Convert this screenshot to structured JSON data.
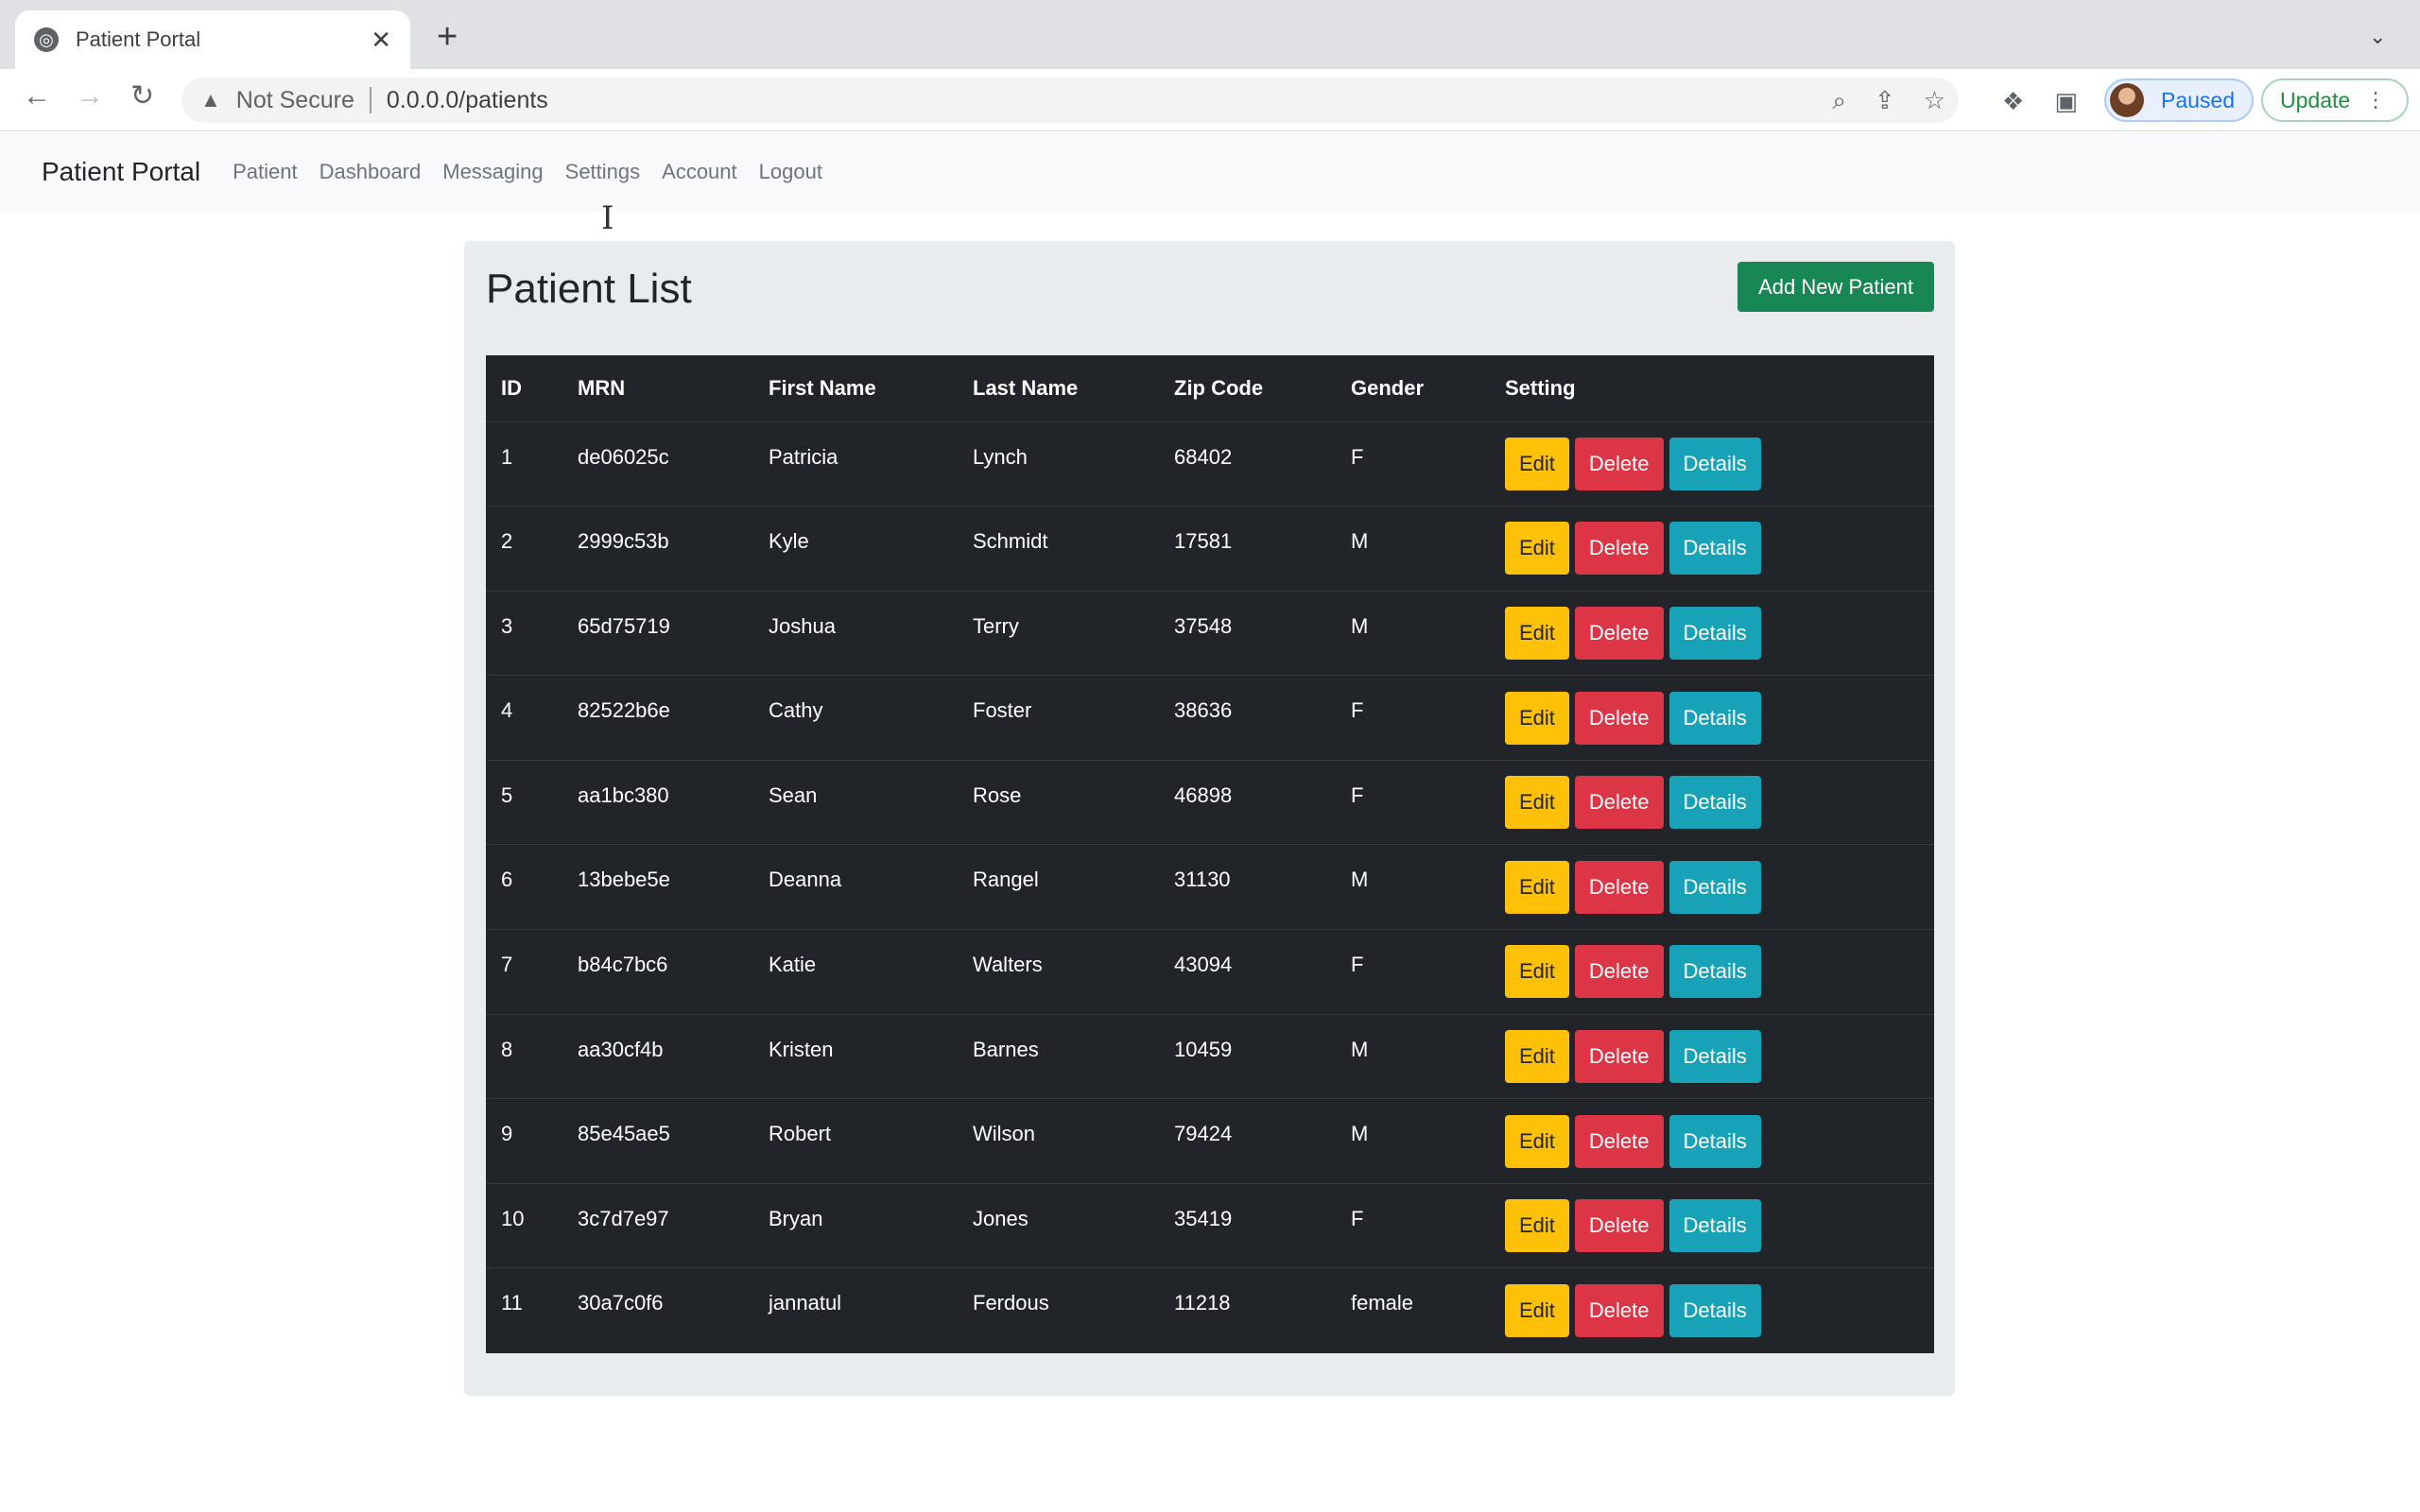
{
  "browser": {
    "tab_title": "Patient Portal",
    "security_label": "Not Secure",
    "url": "0.0.0.0/patients",
    "profile_status": "Paused",
    "update_label": "Update"
  },
  "navbar": {
    "brand": "Patient Portal",
    "links": [
      "Patient",
      "Dashboard",
      "Messaging",
      "Settings",
      "Account",
      "Logout"
    ]
  },
  "main": {
    "title": "Patient List",
    "add_button": "Add New Patient",
    "columns": [
      "ID",
      "MRN",
      "First Name",
      "Last Name",
      "Zip Code",
      "Gender",
      "Setting"
    ],
    "actions": {
      "edit": "Edit",
      "delete": "Delete",
      "details": "Details"
    },
    "rows": [
      {
        "id": "1",
        "mrn": "de06025c",
        "first": "Patricia",
        "last": "Lynch",
        "zip": "68402",
        "gender": "F"
      },
      {
        "id": "2",
        "mrn": "2999c53b",
        "first": "Kyle",
        "last": "Schmidt",
        "zip": "17581",
        "gender": "M"
      },
      {
        "id": "3",
        "mrn": "65d75719",
        "first": "Joshua",
        "last": "Terry",
        "zip": "37548",
        "gender": "M"
      },
      {
        "id": "4",
        "mrn": "82522b6e",
        "first": "Cathy",
        "last": "Foster",
        "zip": "38636",
        "gender": "F"
      },
      {
        "id": "5",
        "mrn": "aa1bc380",
        "first": "Sean",
        "last": "Rose",
        "zip": "46898",
        "gender": "F"
      },
      {
        "id": "6",
        "mrn": "13bebe5e",
        "first": "Deanna",
        "last": "Rangel",
        "zip": "31130",
        "gender": "M"
      },
      {
        "id": "7",
        "mrn": "b84c7bc6",
        "first": "Katie",
        "last": "Walters",
        "zip": "43094",
        "gender": "F"
      },
      {
        "id": "8",
        "mrn": "aa30cf4b",
        "first": "Kristen",
        "last": "Barnes",
        "zip": "10459",
        "gender": "M"
      },
      {
        "id": "9",
        "mrn": "85e45ae5",
        "first": "Robert",
        "last": "Wilson",
        "zip": "79424",
        "gender": "M"
      },
      {
        "id": "10",
        "mrn": "3c7d7e97",
        "first": "Bryan",
        "last": "Jones",
        "zip": "35419",
        "gender": "F"
      },
      {
        "id": "11",
        "mrn": "30a7c0f6",
        "first": "jannatul",
        "last": "Ferdous",
        "zip": "11218",
        "gender": "female"
      }
    ]
  },
  "colors": {
    "success": "#198754",
    "warning": "#ffc107",
    "danger": "#dc3545",
    "info": "#17a2b8",
    "table_dark": "#212529"
  }
}
